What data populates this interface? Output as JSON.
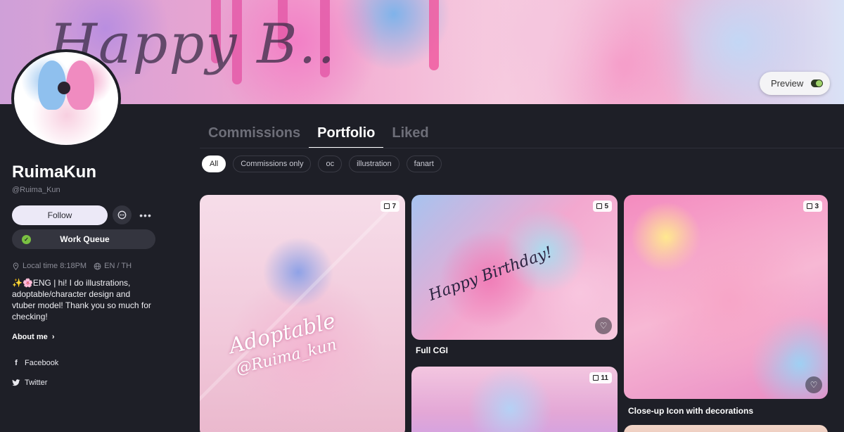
{
  "banner": {
    "script_text": "Happy B..",
    "preview_label": "Preview"
  },
  "profile": {
    "name": "RuimaKun",
    "handle": "@Ruima_Kun",
    "follow_label": "Follow",
    "work_queue_label": "Work Queue",
    "local_time": "Local time 8:18PM",
    "languages": "EN / TH",
    "bio": "✨🌸ENG | hi! I do illustrations, adoptable/character design and vtuber model! Thank you so much for checking!",
    "about_label": "About me",
    "socials": [
      {
        "label": "Facebook",
        "icon": "facebook-icon"
      },
      {
        "label": "Twitter",
        "icon": "twitter-icon"
      }
    ]
  },
  "tabs": [
    {
      "label": "Commissions",
      "active": false
    },
    {
      "label": "Portfolio",
      "active": true
    },
    {
      "label": "Liked",
      "active": false
    }
  ],
  "filters": [
    {
      "label": "All",
      "active": true
    },
    {
      "label": "Commissions only",
      "active": false
    },
    {
      "label": "oc",
      "active": false
    },
    {
      "label": "illustration",
      "active": false
    },
    {
      "label": "fanart",
      "active": false
    }
  ],
  "cards": [
    {
      "count": "7",
      "title": "",
      "image_text": "Adoptable",
      "image_handle": "@Ruima_kun"
    },
    {
      "count": "5",
      "title": "Full CGI",
      "image_text": "Happy Birthday!"
    },
    {
      "count": "3",
      "title": "Close-up Icon with decorations"
    },
    {
      "count": "11",
      "title": ""
    }
  ],
  "colors": {
    "background": "#1e1f27",
    "accent_green": "#7ac142",
    "chip_active": "#ffffff"
  }
}
